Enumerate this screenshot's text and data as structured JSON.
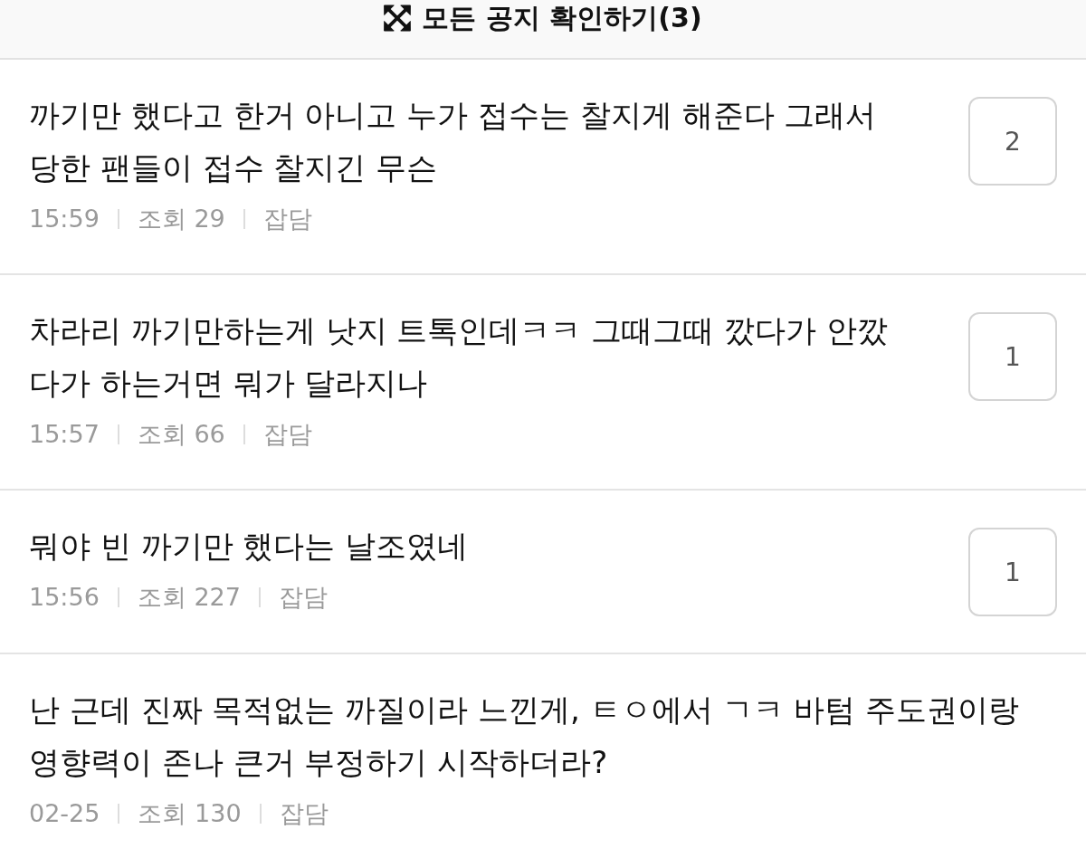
{
  "notice_bar": {
    "label": "모든 공지 확인하기(3)"
  },
  "posts": [
    {
      "title_lines": [
        "까기만 했다고 한거 아니고 누가 접수는 찰지게 해준다 그래서",
        "당한 팬들이 접수 찰지긴 무슨"
      ],
      "time": "15:59",
      "views": "조회 29",
      "category": "잡담",
      "comments": "2"
    },
    {
      "title_lines": [
        "차라리 까기만하는게 낫지 트톡인데ㅋㅋ 그때그때 깠다가 안깠",
        "다가 하는거면 뭐가 달라지나"
      ],
      "time": "15:57",
      "views": "조회 66",
      "category": "잡담",
      "comments": "1"
    },
    {
      "title_lines": [
        "뭐야 빈 까기만 했다는 날조였네"
      ],
      "time": "15:56",
      "views": "조회 227",
      "category": "잡담",
      "comments": "1"
    },
    {
      "title_lines": [
        "난 근데 진짜 목적없는 까질이라 느낀게, ㅌㅇ에서 ㄱㅋ 바텀 주도권이랑",
        "영향력이 존나 큰거 부정하기 시작하더라?"
      ],
      "time": "02-25",
      "views": "조회 130",
      "category": "잡담"
    }
  ]
}
